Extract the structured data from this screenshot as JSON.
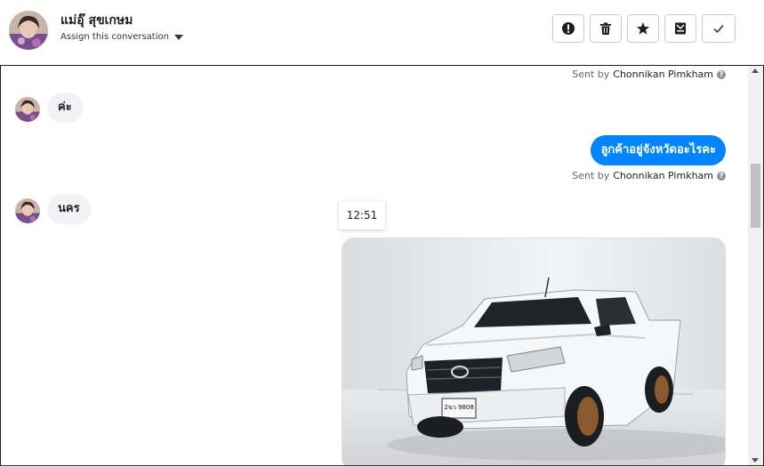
{
  "header": {
    "contact_name": "แม่อุ๊ สุขเกษม",
    "assign_label": "Assign this conversation",
    "actions": [
      "alert-icon",
      "trash-icon",
      "star-icon",
      "archive-icon",
      "check-icon"
    ]
  },
  "messages": {
    "sent_by_label": "Sent by",
    "agent_name": "Chonnikan Pimkham",
    "incoming_1": "ค่ะ",
    "outgoing_1": "ลูกค้าอยู่จังหวัดอะไรคะ",
    "incoming_2": "นคร",
    "timestamp": "12:51"
  },
  "colors": {
    "accent": "#0084ff",
    "bubble_in": "#f0f2f5",
    "border": "#c9ccd1"
  }
}
